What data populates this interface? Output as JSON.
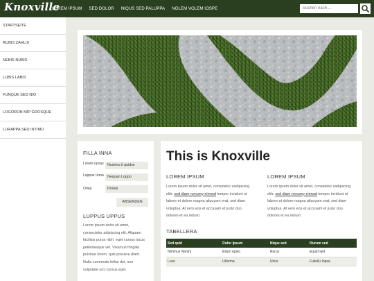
{
  "header": {
    "logo": "Knoxville",
    "nav": [
      "LOREM IPSUM",
      "SED DOLOR",
      "NIQUS SED PALUPPA",
      "NOLEM VOLEM IOSPE"
    ],
    "search_placeholder": "Suchen nach ..."
  },
  "sidebar": {
    "items": [
      "STARTSEITE",
      "RUBIS ZAHLIS",
      "NEBIS NUBIS",
      "LUBIS LABIS",
      "FUNQUE SED NIO",
      "LOGORON MIP GROSQUE",
      "LURAPPA SED INTIMU"
    ]
  },
  "filter": {
    "heading": "FILLA INNA",
    "fields": [
      {
        "label": "Lorem Upsus",
        "value": "Nummu it quidse"
      },
      {
        "label": "Luppus Unna",
        "value": "Nequan Loppo"
      },
      {
        "label": "Orlep",
        "value": "Prolep"
      }
    ],
    "submit": "ABSENDEN"
  },
  "side_text": {
    "heading": "LUPPUS UPPUS",
    "lines": [
      "Lorem ipsum dolor sit amet,",
      "consectetur adipiscing elit. Aliquam",
      "facilisis purus nibh, eget cursus lacus",
      "pellentesque vel. Vivamus fringilla",
      "pulvinar lorem, quis posuere diam.",
      "Nulla commodo tellus dui, non",
      "vulputate orci cursus eget."
    ]
  },
  "main": {
    "title": "This is Knoxville",
    "col1": {
      "heading": "LOREM IPSUM",
      "line1": "Lorem ipsum dolor sit amet, consetetur sadipscing",
      "line2_pre": "elitr, ",
      "line2_link": "sed diam nonumy eirmod",
      "line2_post": " tempor invidunt ut",
      "line3": "labore et dolore magna aliquyam erat, sed diam",
      "line4": "voluptua. At vero eos et accusam et justo duo",
      "line5": "dolores et ea rebum."
    },
    "col2": {
      "heading": "LOREM IPSUM",
      "line1": "Lorem ipsum dolor sit amet, consetetur sadipscing",
      "line2_pre": "elitr, ",
      "line2_link": "sed diam nonumy eirmod",
      "line2_post": " tempor invidunt ut",
      "line3": "labore et dolore magna aliquyam erat, sed diam",
      "line4": "voluptua. At vero eos et accusam et justo duo",
      "line5": "dolores et ea rebum."
    },
    "table": {
      "heading": "TABELLERA",
      "headers": [
        "Sed quid",
        "Dolor Ipsum",
        "Nique sed",
        "Illurum sed"
      ],
      "rows": [
        [
          "Nimmus Nimmi",
          "Ellum epsio",
          "Nurus",
          "Equid sed"
        ],
        [
          "Luso",
          "Lillerma",
          "Ulrus",
          "Fukullu Iopsa"
        ]
      ]
    }
  }
}
